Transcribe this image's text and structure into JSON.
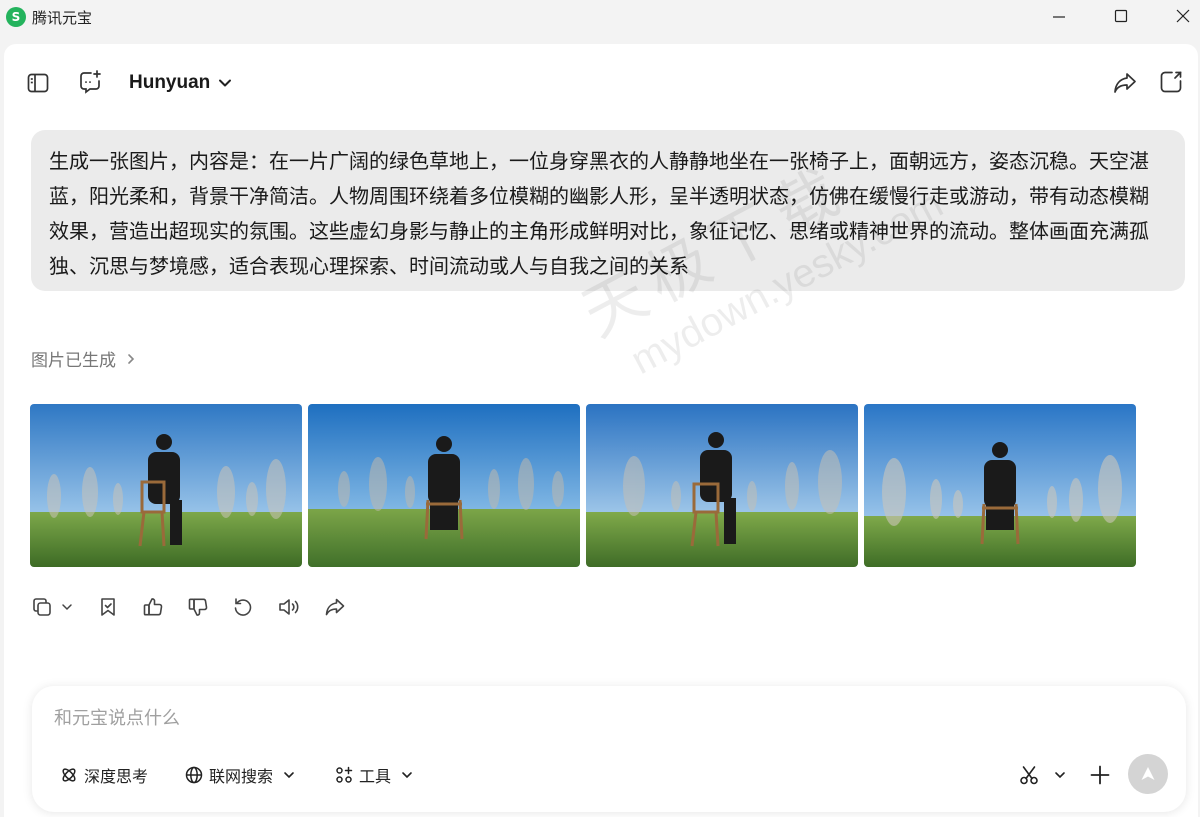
{
  "window": {
    "title": "腾讯元宝",
    "logo_glyph": "S",
    "accent_color": "#24b35d"
  },
  "header": {
    "model_name": "Hunyuan",
    "icons": [
      "sidebar-toggle-icon",
      "new-chat-icon",
      "chevron-down-icon",
      "share-icon",
      "new-window-icon"
    ]
  },
  "conversation": {
    "user_message": "生成一张图片，内容是：在一片广阔的绿色草地上，一位身穿黑衣的人静静地坐在一张椅子上，面朝远方，姿态沉稳。天空湛蓝，阳光柔和，背景干净简洁。人物周围环绕着多位模糊的幽影人形，呈半透明状态，仿佛在缓慢行走或游动，带有动态模糊效果，营造出超现实的氛围。这些虚幻身影与静止的主角形成鲜明对比，象征记忆、思绪或精神世界的流动。整体画面充满孤独、沉思与梦境感，适合表现心理探索、时间流动或人与自我之间的关系",
    "status_text": "图片已生成",
    "image_count": 4,
    "action_icons": [
      "copy-icon",
      "chevron-down-icon",
      "bookmark-icon",
      "thumbs-up-icon",
      "thumbs-down-icon",
      "regenerate-icon",
      "read-aloud-icon",
      "share-icon"
    ]
  },
  "watermark": {
    "main": "天极下载",
    "sub": "mydown.yesky.com"
  },
  "composer": {
    "placeholder": "和元宝说点什么",
    "tools": {
      "deep_think": "深度思考",
      "web_search": "联网搜索",
      "tools": "工具"
    },
    "right_icons": [
      "scissors-icon",
      "chevron-down-icon",
      "plus-icon",
      "send-icon"
    ]
  }
}
